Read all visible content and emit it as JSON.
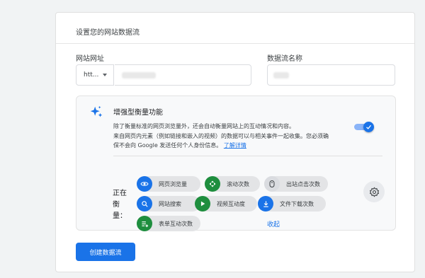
{
  "card": {
    "title": "设置您的网站数据流"
  },
  "url_field": {
    "label": "网站网址",
    "protocol": "htt..."
  },
  "name_field": {
    "label": "数据流名称"
  },
  "enhanced": {
    "title": "增强型衡量功能",
    "desc_line1": "除了衡量标准的网页浏览量外，还会自动衡量网站上的互动情况和内容。",
    "desc_line2": "来自网页内元素（例如链接和嵌入的视频）的数据可以与相关事件一起收集。您必须确",
    "desc_line3": "保不会向 Google 发送任何个人身份信息。",
    "learn_more": "了解详情",
    "toggle_on": true,
    "measuring_label": "正在衡量：",
    "events": [
      {
        "label": "网页浏览量",
        "icon": "eye-icon"
      },
      {
        "label": "滚动次数",
        "icon": "scroll-icon"
      },
      {
        "label": "出站点击次数",
        "icon": "mouse-icon"
      },
      {
        "label": "网站搜索",
        "icon": "search-icon"
      },
      {
        "label": "视频互动度",
        "icon": "play-icon"
      },
      {
        "label": "文件下载次数",
        "icon": "download-icon"
      },
      {
        "label": "表单互动次数",
        "icon": "form-icon"
      }
    ],
    "collapse": "收起"
  },
  "create_button": "创建数据流",
  "colors": {
    "accent": "#1a73e8",
    "green": "#1e8e3e",
    "chip_bg": "#e3e4e6"
  }
}
